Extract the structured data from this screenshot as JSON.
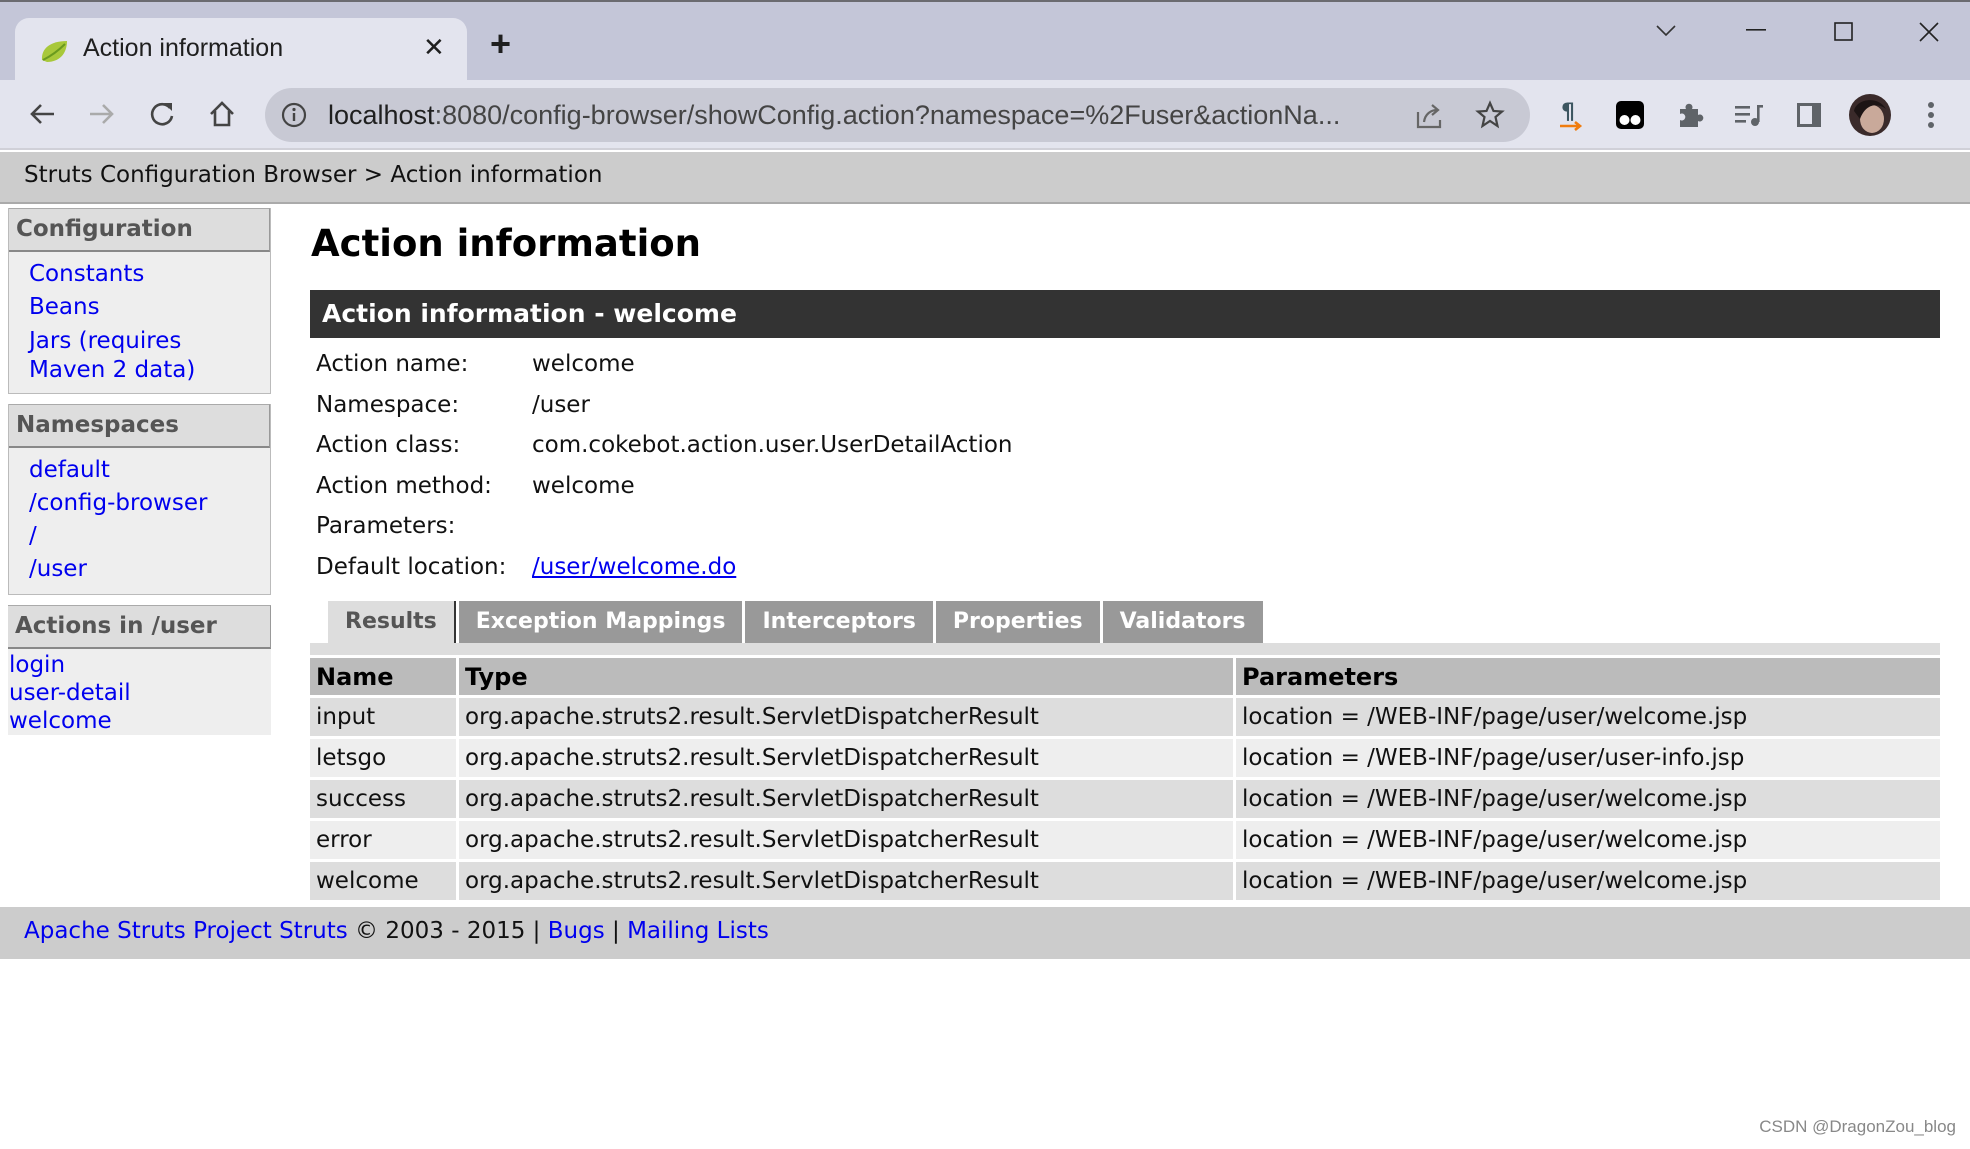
{
  "browser": {
    "tab_title": "Action information",
    "new_tab_label": "+",
    "url_host": "localhost",
    "url_rest": ":8080/config-browser/showConfig.action?namespace=%2Fuser&actionNa...",
    "window_controls": [
      "chevron-down",
      "minimize",
      "maximize",
      "close"
    ],
    "extensions": [
      "pilcrow-extension",
      "tampermonkey-extension",
      "extensions-puzzle",
      "reading-list",
      "side-panel",
      "profile-avatar",
      "more-menu"
    ]
  },
  "breadcrumb": {
    "root": "Struts Configuration Browser",
    "separator": ">",
    "current": "Action information"
  },
  "sidebar": {
    "configuration": {
      "title": "Configuration",
      "items": [
        "Constants",
        "Beans",
        "Jars (requires Maven 2 data)"
      ]
    },
    "namespaces": {
      "title": "Namespaces",
      "items": [
        "default",
        "/config-browser",
        "/",
        "/user"
      ]
    },
    "actions": {
      "title": "Actions in /user",
      "items": [
        "login",
        "user-detail",
        "welcome"
      ]
    }
  },
  "main": {
    "heading": "Action information",
    "section_title": "Action information - welcome",
    "info": [
      {
        "label": "Action name:",
        "value": "welcome"
      },
      {
        "label": "Namespace:",
        "value": "/user"
      },
      {
        "label": "Action class:",
        "value": "com.cokebot.action.user.UserDetailAction"
      },
      {
        "label": "Action method:",
        "value": "welcome"
      },
      {
        "label": "Parameters:",
        "value": ""
      },
      {
        "label": "Default location:",
        "value": "/user/welcome.do",
        "is_link": true
      }
    ],
    "tabs": [
      {
        "label": "Results",
        "active": true
      },
      {
        "label": "Exception Mappings",
        "active": false
      },
      {
        "label": "Interceptors",
        "active": false
      },
      {
        "label": "Properties",
        "active": false
      },
      {
        "label": "Validators",
        "active": false
      }
    ],
    "results_table": {
      "columns": [
        "Name",
        "Type",
        "Parameters"
      ],
      "rows": [
        [
          "input",
          "org.apache.struts2.result.ServletDispatcherResult",
          "location = /WEB-INF/page/user/welcome.jsp"
        ],
        [
          "letsgo",
          "org.apache.struts2.result.ServletDispatcherResult",
          "location = /WEB-INF/page/user/user-info.jsp"
        ],
        [
          "success",
          "org.apache.struts2.result.ServletDispatcherResult",
          "location = /WEB-INF/page/user/welcome.jsp"
        ],
        [
          "error",
          "org.apache.struts2.result.ServletDispatcherResult",
          "location = /WEB-INF/page/user/welcome.jsp"
        ],
        [
          "welcome",
          "org.apache.struts2.result.ServletDispatcherResult",
          "location = /WEB-INF/page/user/welcome.jsp"
        ]
      ]
    }
  },
  "footer": {
    "project_link": "Apache Struts Project Struts",
    "copyright": "© 2003 - 2015",
    "sep": "|",
    "bugs_link": "Bugs",
    "mailing_link": "Mailing Lists"
  },
  "watermark": "CSDN @DragonZou_blog",
  "colors": {
    "link": "#0000ee",
    "header_dark": "#333333",
    "tab_inactive": "#999999",
    "row_dark": "#dddddd",
    "row_light": "#eeeeee",
    "bar_gray": "#cccccc"
  }
}
